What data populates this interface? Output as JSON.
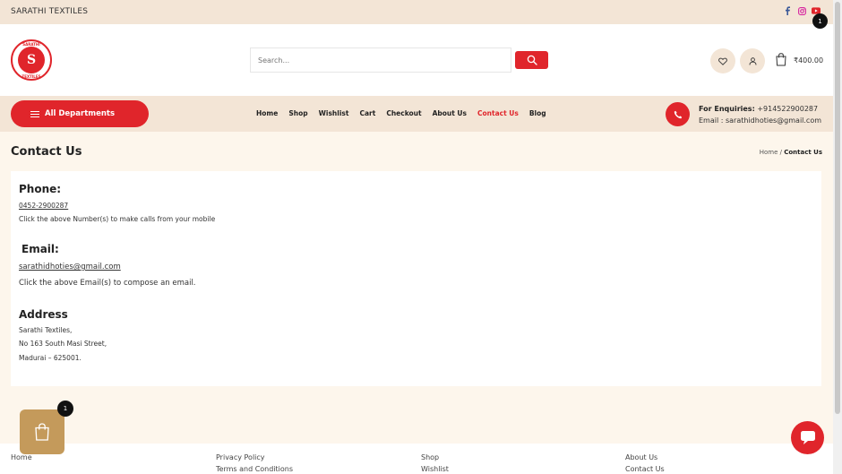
{
  "topbar": {
    "brand": "SARATHI TEXTILES",
    "social": [
      "facebook-icon",
      "instagram-icon",
      "youtube-icon"
    ]
  },
  "logo": {
    "mark": "S",
    "ring_top": "SARATHI",
    "ring_bottom": "TEXTILES"
  },
  "search": {
    "placeholder": "Search..."
  },
  "cart": {
    "count": "1",
    "total": "₹400.00"
  },
  "nav": {
    "departments": "All Departments",
    "items": [
      "Home",
      "Shop",
      "Wishlist",
      "Cart",
      "Checkout",
      "About Us",
      "Contact Us",
      "Blog"
    ],
    "active": "Contact Us"
  },
  "enquiry": {
    "label": "For Enquiries:",
    "phone": "+914522900287",
    "email_label": "Email :",
    "email": "sarathidhoties@gmail.com"
  },
  "page": {
    "title": "Contact Us",
    "breadcrumb_home": "Home",
    "breadcrumb_sep": "/",
    "breadcrumb_current": "Contact Us"
  },
  "contact": {
    "phone_heading": "Phone:",
    "phone_number": "0452-2900287",
    "phone_note": "Click the above Number(s) to make calls from your mobile",
    "email_heading": "Email:",
    "email_address": "sarathidhoties@gmail.com",
    "email_note": "Click the above Email(s) to compose an email.",
    "address_heading": "Address",
    "address_lines": [
      "Sarathi Textiles,",
      "No 163 South Masi Street,",
      "Madurai – 625001."
    ]
  },
  "floating_cart": {
    "count": "1"
  },
  "footer": {
    "col1": [
      "Home"
    ],
    "col2": [
      "Privacy Policy",
      "Terms and Conditions"
    ],
    "col3": [
      "Shop",
      "Wishlist"
    ],
    "col4": [
      "About Us",
      "Contact Us"
    ]
  },
  "colors": {
    "accent": "#e0252b",
    "beige": "#f3e5d6",
    "page_bg": "#fdf6ec",
    "gold": "#c49a5b"
  }
}
